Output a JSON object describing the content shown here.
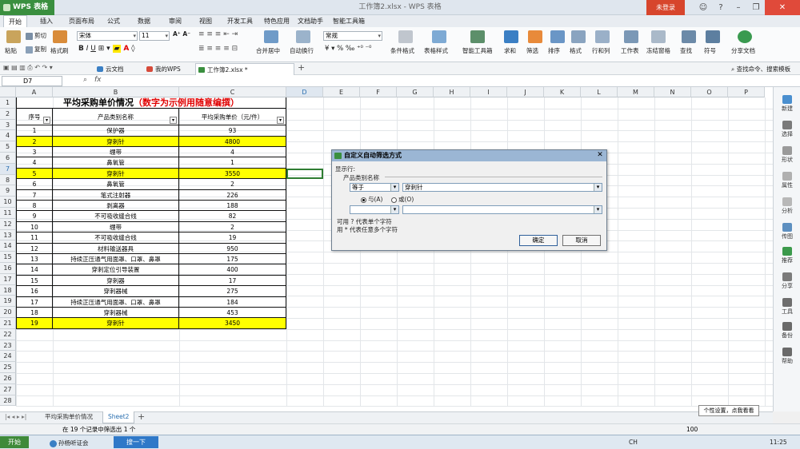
{
  "app": {
    "name": "WPS 表格",
    "window_title": "工作簿2.xlsx - WPS 表格",
    "login": "未登录"
  },
  "menu_tabs": [
    "开始",
    "插入",
    "页面布局",
    "公式",
    "数据",
    "审阅",
    "视图",
    "开发工具",
    "特色应用",
    "文档助手",
    "智能工具箱"
  ],
  "ribbon": {
    "paste": "粘贴",
    "cut": "剪切",
    "copy": "复制",
    "format_painter": "格式刷",
    "font_name": "宋体",
    "font_size": "11",
    "merge": "合并居中",
    "wrap": "自动换行",
    "number_format": "常规",
    "cond_format": "条件格式",
    "table_style": "表格样式",
    "smart_toolbox": "智能工具箱",
    "sum": "求和",
    "filter": "筛选",
    "sort": "排序",
    "format": "格式",
    "rowcol": "行和列",
    "worksheet": "工作表",
    "freeze": "冻结窗格",
    "find": "查找",
    "symbol": "符号",
    "share": "分享文档"
  },
  "doc_tabs": [
    "云文档",
    "我的WPS",
    "工作簿2.xlsx *"
  ],
  "search_hint": "查找命令、搜索模板",
  "name_box": "D7",
  "fx": "fx",
  "columns": [
    "A",
    "B",
    "C",
    "D",
    "E",
    "F",
    "G",
    "H",
    "I",
    "J",
    "K",
    "L",
    "M",
    "N",
    "O",
    "P"
  ],
  "sheet": {
    "title_black": "平均采购单价情况",
    "title_red": "（数字为示例用随意编撰）",
    "headers": [
      "序号",
      "产品类别名称",
      "平均采购单价（元/件）"
    ],
    "rows": [
      {
        "n": "1",
        "name": "保护器",
        "price": "93",
        "hl": false
      },
      {
        "n": "2",
        "name": "穿刺针",
        "price": "4800",
        "hl": true
      },
      {
        "n": "3",
        "name": "绷带",
        "price": "4",
        "hl": false
      },
      {
        "n": "4",
        "name": "鼻氧管",
        "price": "1",
        "hl": false
      },
      {
        "n": "5",
        "name": "穿刺针",
        "price": "3550",
        "hl": true
      },
      {
        "n": "6",
        "name": "鼻氧管",
        "price": "2",
        "hl": false
      },
      {
        "n": "7",
        "name": "笔式注射器",
        "price": "226",
        "hl": false
      },
      {
        "n": "8",
        "name": "剥离器",
        "price": "188",
        "hl": false
      },
      {
        "n": "9",
        "name": "不可吸收缝合线",
        "price": "82",
        "hl": false
      },
      {
        "n": "10",
        "name": "绷带",
        "price": "2",
        "hl": false
      },
      {
        "n": "11",
        "name": "不可吸收缝合线",
        "price": "19",
        "hl": false
      },
      {
        "n": "12",
        "name": "材料输送器具",
        "price": "950",
        "hl": false
      },
      {
        "n": "13",
        "name": "持续正压通气用面罩、口罩、鼻罩",
        "price": "175",
        "hl": false
      },
      {
        "n": "14",
        "name": "穿刺定位引导装置",
        "price": "400",
        "hl": false
      },
      {
        "n": "15",
        "name": "穿刺器",
        "price": "17",
        "hl": false
      },
      {
        "n": "16",
        "name": "穿刺器械",
        "price": "275",
        "hl": false
      },
      {
        "n": "17",
        "name": "持续正压通气用面罩、口罩、鼻罩",
        "price": "184",
        "hl": false
      },
      {
        "n": "18",
        "name": "穿刺器械",
        "price": "453",
        "hl": false
      },
      {
        "n": "19",
        "name": "穿刺针",
        "price": "3450",
        "hl": true
      }
    ]
  },
  "right_panel": [
    "新建",
    "选择",
    "形状",
    "属性",
    "分析",
    "传图",
    "推荐",
    "分享",
    "工具",
    "备份",
    "帮助"
  ],
  "sheet_tabs": [
    "平均采购单价情况",
    "Sheet2"
  ],
  "status": "在 19 个记录中筛选出 1 个",
  "zoom": "100",
  "dialog": {
    "title": "自定义自动筛选方式",
    "show_rows": "显示行:",
    "field": "产品类别名称",
    "op1": "等于",
    "val1": "穿刺针",
    "and": "与(A)",
    "or": "或(O)",
    "op2": "",
    "val2": "",
    "hint1": "可用 ? 代表单个字符",
    "hint2": "用 * 代表任意多个字符",
    "ok": "确定",
    "cancel": "取消"
  },
  "tooltip": "个性设置，点我看看",
  "taskbar": {
    "start": "开始",
    "app1": "孙杨听证会",
    "search": "搜一下",
    "ime": "CH",
    "time": "11:25"
  },
  "colors": {
    "highlight": "#ffff00",
    "title_red": "#e00000",
    "wps_green": "#3a8f3f"
  }
}
